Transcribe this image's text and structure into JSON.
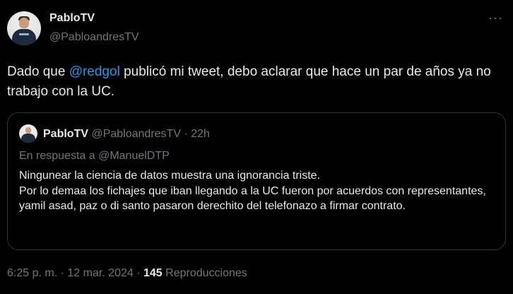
{
  "tweet": {
    "display_name": "PabloTV",
    "handle": "@PabloandresTV",
    "more_icon": "more-horizontal-icon",
    "text_before_mention": "Dado que ",
    "mention": "@redgol",
    "text_after_mention": " publicó mi tweet, debo aclarar que hace un par de años ya no trabajo con la UC.",
    "mention_color": "#1d9bf0"
  },
  "quoted_tweet": {
    "display_name": "PabloTV",
    "handle": "@PabloandresTV",
    "separator": " · ",
    "time": "22h",
    "reply_prefix": "En respuesta a @ManuelDTP",
    "lines": [
      "Ningunear la ciencia de datos muestra una ignorancia triste.",
      "Por lo demaa los fichajes que iban llegando a la UC fueron por acuerdos con representantes, yamil asad, paz o di santo pasaron derechito del telefonazo a firmar contrato."
    ]
  },
  "meta": {
    "time": "6:25 p. m.",
    "separator": " · ",
    "date": "12 mar. 2024",
    "views_count": "145",
    "views_label": " Reproducciones"
  },
  "colors": {
    "background": "#000000",
    "text": "#e7e9ea",
    "muted": "#71767b",
    "border": "#2f3336",
    "accent": "#1d9bf0"
  }
}
